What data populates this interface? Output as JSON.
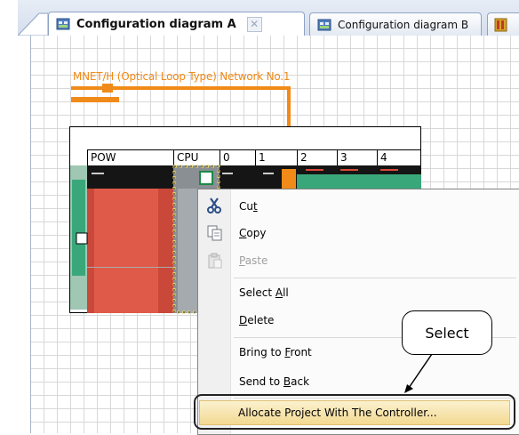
{
  "tabs": [
    {
      "label": "Configuration diagram A",
      "active": true,
      "close_label": "✕"
    },
    {
      "label": "Configuration diagram B",
      "active": false
    }
  ],
  "diagram": {
    "network_label": "MNET/H (Optical Loop Type) Network No.1",
    "slots": [
      "POW",
      "CPU",
      "0",
      "1",
      "2",
      "3",
      "4"
    ]
  },
  "context_menu": {
    "items": [
      {
        "label": "Cut",
        "accel": "t",
        "icon": "scissors-icon",
        "enabled": true
      },
      {
        "label": "Copy",
        "accel": "C",
        "icon": "copy-icon",
        "enabled": true
      },
      {
        "label": "Paste",
        "accel": "P",
        "icon": "paste-icon",
        "enabled": false
      },
      {
        "label": "Select All",
        "accel": "A",
        "enabled": true
      },
      {
        "label": "Delete",
        "accel": "D",
        "enabled": true
      },
      {
        "label": "Bring to Front",
        "accel": "F",
        "enabled": true
      },
      {
        "label": "Send to Back",
        "accel": "B",
        "enabled": true
      },
      {
        "label": "Allocate Project With The Controller...",
        "enabled": true,
        "highlighted": true
      }
    ]
  },
  "annotation": {
    "callout_text": "Select"
  },
  "colors": {
    "network": "#f08a18",
    "module_red": "#e05a4a",
    "module_green": "#3aa77a",
    "highlight": "#f3d991"
  }
}
